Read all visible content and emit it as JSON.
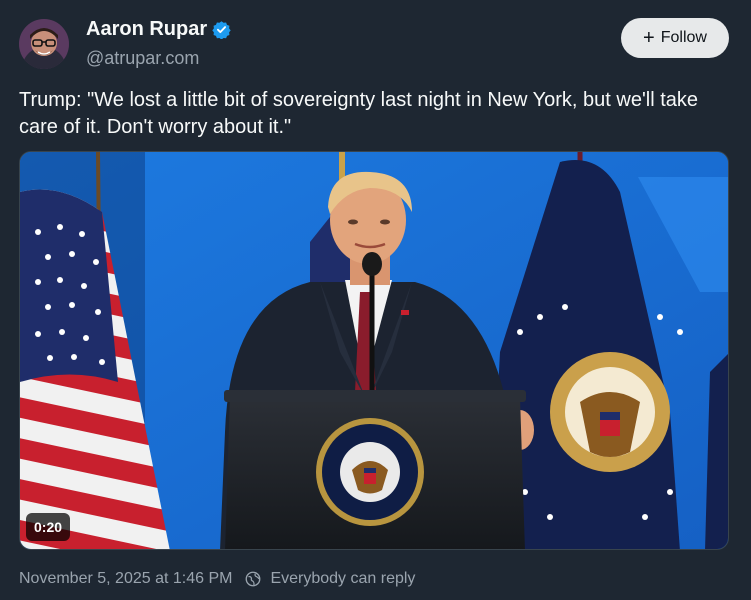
{
  "author": {
    "display_name": "Aaron Rupar",
    "handle": "@atrupar.com",
    "verified": true,
    "avatar_icon": "avatar-photo"
  },
  "follow_button": {
    "label": "Follow",
    "icon": "plus-icon"
  },
  "post": {
    "text": "Trump: \"We lost a little bit of sovereignty last night in New York, but we'll take care of it. Don't worry about it.\""
  },
  "media": {
    "type": "video",
    "duration": "0:20",
    "seal_text_top": "PRESIDENT OF THE UNITED",
    "seal_text_bottom": "SEAL OF THE · STATES"
  },
  "footer": {
    "timestamp": "November 5, 2025 at 1:46 PM",
    "reply_setting": "Everybody can reply",
    "reply_icon": "globe-icon"
  },
  "colors": {
    "background": "#1e2732",
    "text": "#f7f9f9",
    "muted": "#9aa4ae",
    "verified": "#1d9bf0",
    "follow_bg": "#e7e9ea",
    "stage_blue": "#1a6fd6"
  }
}
